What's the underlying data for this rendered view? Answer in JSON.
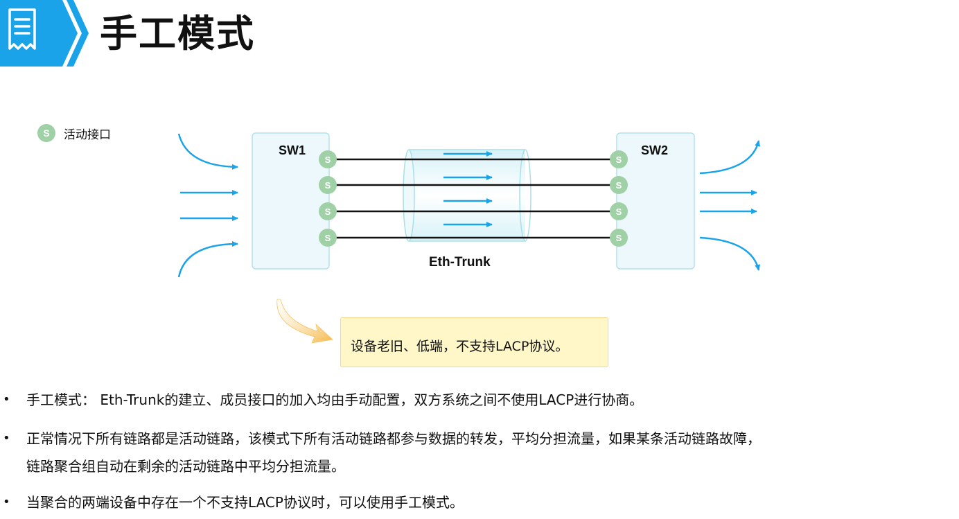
{
  "header": {
    "title": "手工模式",
    "icon": "document-list-icon",
    "accent_color": "#1aa3e8"
  },
  "legend": {
    "marker": "S",
    "label": "活动接口",
    "marker_color": "#9fd0a6"
  },
  "diagram": {
    "switch_left": "SW1",
    "switch_right": "SW2",
    "port_label": "S",
    "trunk_label": "Eth-Trunk",
    "link_count": 4,
    "arrow_color": "#1aa3e8"
  },
  "note": {
    "text": "设备老旧、低端，不支持LACP协议。"
  },
  "bullets": [
    "手工模式： Eth-Trunk的建立、成员接口的加入均由手动配置，双方系统之间不使用LACP进行协商。",
    "正常情况下所有链路都是活动链路，该模式下所有活动链路都参与数据的转发，平均分担流量，如果某条活动链路故障，",
    "链路聚合组自动在剩余的活动链路中平均分担流量。",
    "当聚合的两端设备中存在一个不支持LACP协议时，可以使用手工模式。"
  ]
}
